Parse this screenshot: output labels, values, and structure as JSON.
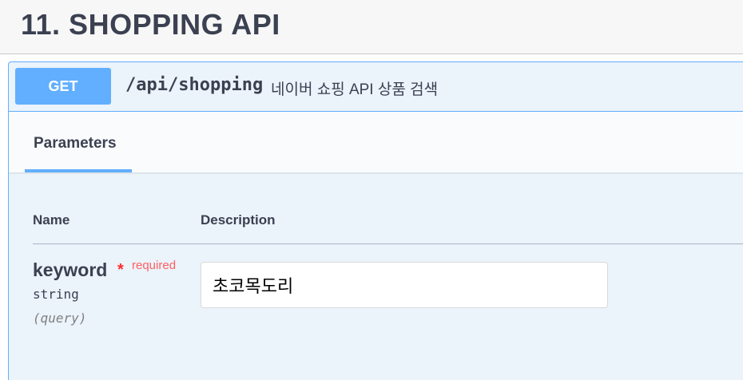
{
  "section": {
    "title": "11. SHOPPING API"
  },
  "operation": {
    "method": "GET",
    "path": "/api/shopping",
    "description": "네이버 쇼핑 API 상품 검색"
  },
  "tabs": {
    "parameters_label": "Parameters"
  },
  "table": {
    "columns": [
      "Name",
      "Description"
    ]
  },
  "parameters": [
    {
      "name": "keyword",
      "required_star": "*",
      "required_label": "required",
      "type": "string",
      "in": "(query)",
      "value": "초코목도리"
    }
  ],
  "colors": {
    "get_method": "#61affe",
    "opblock_bg": "#ebf3fb",
    "required": "#ff2c2c",
    "text": "#3b4151"
  }
}
